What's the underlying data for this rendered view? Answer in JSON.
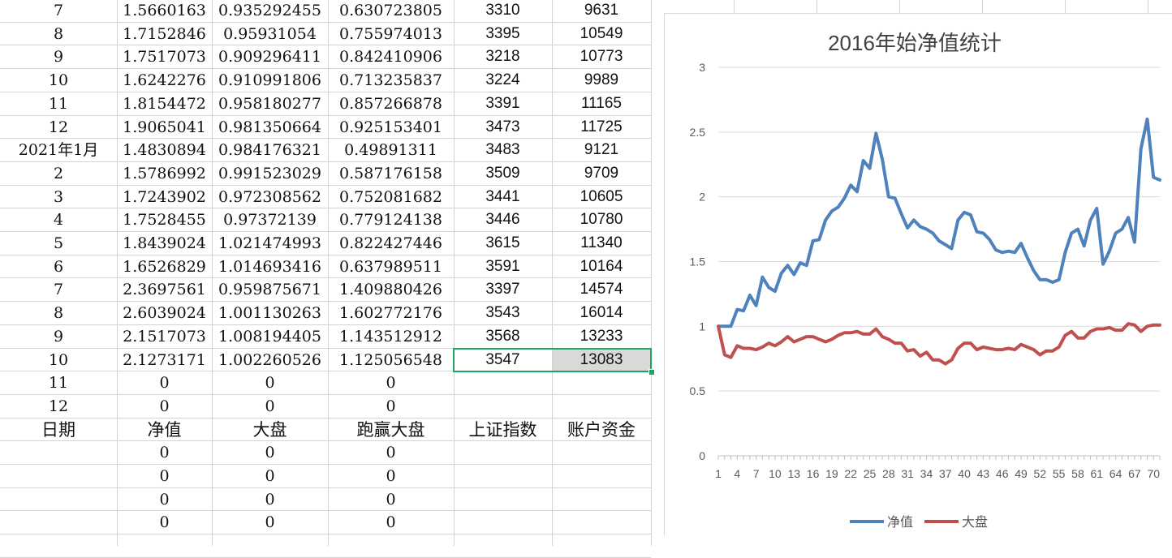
{
  "sheet": {
    "rows": [
      {
        "c": [
          "7",
          "1.5660163",
          "0.935292455",
          "0.630723805",
          "3310",
          "9631"
        ]
      },
      {
        "c": [
          "8",
          "1.7152846",
          "0.95931054",
          "0.755974013",
          "3395",
          "10549"
        ]
      },
      {
        "c": [
          "9",
          "1.7517073",
          "0.909296411",
          "0.842410906",
          "3218",
          "10773"
        ]
      },
      {
        "c": [
          "10",
          "1.6242276",
          "0.910991806",
          "0.713235837",
          "3224",
          "9989"
        ]
      },
      {
        "c": [
          "11",
          "1.8154472",
          "0.958180277",
          "0.857266878",
          "3391",
          "11165"
        ]
      },
      {
        "c": [
          "12",
          "1.9065041",
          "0.981350664",
          "0.925153401",
          "3473",
          "11725"
        ]
      },
      {
        "c": [
          "2021年1月",
          "1.4830894",
          "0.984176321",
          "0.49891311",
          "3483",
          "9121"
        ]
      },
      {
        "c": [
          "2",
          "1.5786992",
          "0.991523029",
          "0.587176158",
          "3509",
          "9709"
        ]
      },
      {
        "c": [
          "3",
          "1.7243902",
          "0.972308562",
          "0.752081682",
          "3441",
          "10605"
        ]
      },
      {
        "c": [
          "4",
          "1.7528455",
          "0.97372139",
          "0.779124138",
          "3446",
          "10780"
        ]
      },
      {
        "c": [
          "5",
          "1.8439024",
          "1.021474993",
          "0.822427446",
          "3615",
          "11340"
        ]
      },
      {
        "c": [
          "6",
          "1.6526829",
          "1.014693416",
          "0.637989511",
          "3591",
          "10164"
        ]
      },
      {
        "c": [
          "7",
          "2.3697561",
          "0.959875671",
          "1.409880426",
          "3397",
          "14574"
        ]
      },
      {
        "c": [
          "8",
          "2.6039024",
          "1.001130263",
          "1.602772176",
          "3543",
          "16014"
        ]
      },
      {
        "c": [
          "9",
          "2.1517073",
          "1.008194405",
          "1.143512912",
          "3568",
          "13233"
        ]
      },
      {
        "c": [
          "10",
          "2.1273171",
          "1.002260526",
          "1.125056548",
          "3547",
          "13083"
        ]
      },
      {
        "c": [
          "11",
          "0",
          "0",
          "0",
          "",
          ""
        ]
      },
      {
        "c": [
          "12",
          "0",
          "0",
          "0",
          "",
          ""
        ]
      },
      {
        "c": [
          "日期",
          "净值",
          "大盘",
          "跑赢大盘",
          "上证指数",
          "账户资金"
        ],
        "header": true
      },
      {
        "c": [
          "",
          "0",
          "0",
          "0",
          "",
          ""
        ]
      },
      {
        "c": [
          "",
          "0",
          "0",
          "0",
          "",
          ""
        ]
      },
      {
        "c": [
          "",
          "0",
          "0",
          "0",
          "",
          ""
        ]
      },
      {
        "c": [
          "",
          "0",
          "0",
          "0",
          "",
          ""
        ]
      }
    ],
    "selection": {
      "row": 15,
      "from_col": 4,
      "to_col": 5
    },
    "selection_color": "#21a366"
  },
  "chart_data": {
    "type": "line",
    "title": "2016年始净值统计",
    "ylim": [
      0,
      3
    ],
    "yticks": [
      0,
      0.5,
      1,
      1.5,
      2,
      2.5,
      3
    ],
    "ytick_labels": [
      "0",
      "0.5",
      "1",
      "1.5",
      "2",
      "2.5",
      "3"
    ],
    "x": [
      1,
      2,
      3,
      4,
      5,
      6,
      7,
      8,
      9,
      10,
      11,
      12,
      13,
      14,
      15,
      16,
      17,
      18,
      19,
      20,
      21,
      22,
      23,
      24,
      25,
      26,
      27,
      28,
      29,
      30,
      31,
      32,
      33,
      34,
      35,
      36,
      37,
      38,
      39,
      40,
      41,
      42,
      43,
      44,
      45,
      46,
      47,
      48,
      49,
      50,
      51,
      52,
      53,
      54,
      55,
      56,
      57,
      58,
      59,
      60,
      61,
      62,
      63,
      64,
      65,
      66,
      67,
      68,
      69,
      70,
      71
    ],
    "xtick_labels": [
      "1",
      "4",
      "7",
      "10",
      "13",
      "16",
      "19",
      "22",
      "25",
      "28",
      "31",
      "34",
      "37",
      "40",
      "43",
      "46",
      "49",
      "52",
      "55",
      "58",
      "61",
      "64",
      "67",
      "70"
    ],
    "grid": true,
    "legend": "bottom",
    "series": [
      {
        "name": "净值",
        "color": "#4f81bd",
        "values": [
          1.0,
          1.0,
          1.0,
          1.13,
          1.12,
          1.24,
          1.16,
          1.38,
          1.3,
          1.27,
          1.41,
          1.47,
          1.4,
          1.49,
          1.47,
          1.66,
          1.67,
          1.82,
          1.89,
          1.92,
          1.99,
          2.09,
          2.04,
          2.28,
          2.22,
          2.49,
          2.29,
          2.0,
          1.99,
          1.87,
          1.76,
          1.82,
          1.77,
          1.75,
          1.72,
          1.66,
          1.63,
          1.6,
          1.82,
          1.88,
          1.86,
          1.73,
          1.72,
          1.67,
          1.59,
          1.57,
          1.58,
          1.57,
          1.64,
          1.53,
          1.43,
          1.36,
          1.36,
          1.34,
          1.36,
          1.57,
          1.72,
          1.75,
          1.62,
          1.82,
          1.91,
          1.48,
          1.58,
          1.72,
          1.75,
          1.84,
          1.65,
          2.37,
          2.6,
          2.15,
          2.13
        ]
      },
      {
        "name": "大盘",
        "color": "#c0504d",
        "values": [
          1.0,
          0.78,
          0.76,
          0.85,
          0.83,
          0.83,
          0.82,
          0.84,
          0.87,
          0.85,
          0.88,
          0.92,
          0.88,
          0.9,
          0.92,
          0.92,
          0.9,
          0.88,
          0.9,
          0.93,
          0.95,
          0.95,
          0.96,
          0.94,
          0.94,
          0.98,
          0.92,
          0.9,
          0.87,
          0.87,
          0.81,
          0.82,
          0.77,
          0.8,
          0.74,
          0.74,
          0.71,
          0.74,
          0.83,
          0.87,
          0.87,
          0.82,
          0.84,
          0.83,
          0.82,
          0.82,
          0.83,
          0.82,
          0.86,
          0.84,
          0.82,
          0.78,
          0.81,
          0.81,
          0.84,
          0.93,
          0.96,
          0.91,
          0.91,
          0.96,
          0.98,
          0.98,
          0.99,
          0.97,
          0.97,
          1.02,
          1.01,
          0.96,
          1.0,
          1.01,
          1.01
        ]
      }
    ]
  }
}
